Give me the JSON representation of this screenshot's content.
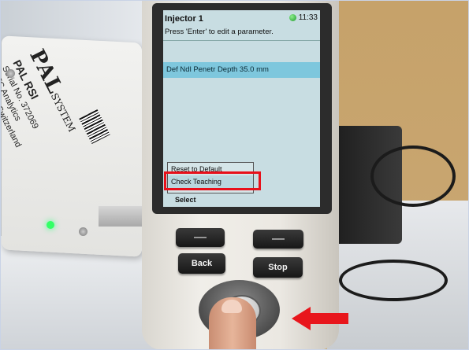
{
  "screen": {
    "title": "Injector 1",
    "time": "11:33",
    "prompt": "Press 'Enter' to edit a parameter.",
    "parameter": "Def Ndl Penetr Depth 35.0 mm",
    "menu_items": [
      "Reset to Default",
      "Check Teaching"
    ],
    "softkey_label": "Select"
  },
  "keys": {
    "left_softkey": "—",
    "right_softkey": "—",
    "back": "Back",
    "stop": "Stop"
  },
  "device_label": {
    "logo": "PAL",
    "logo_suffix": "SYSTEM",
    "model": "PAL RSI",
    "serial": "Serial No. 372069",
    "brand": "CTC Analytics",
    "origin": "Made in Switzerland"
  },
  "annotation_colors": {
    "highlight": "#e8101a",
    "arrow": "#e8161c"
  }
}
